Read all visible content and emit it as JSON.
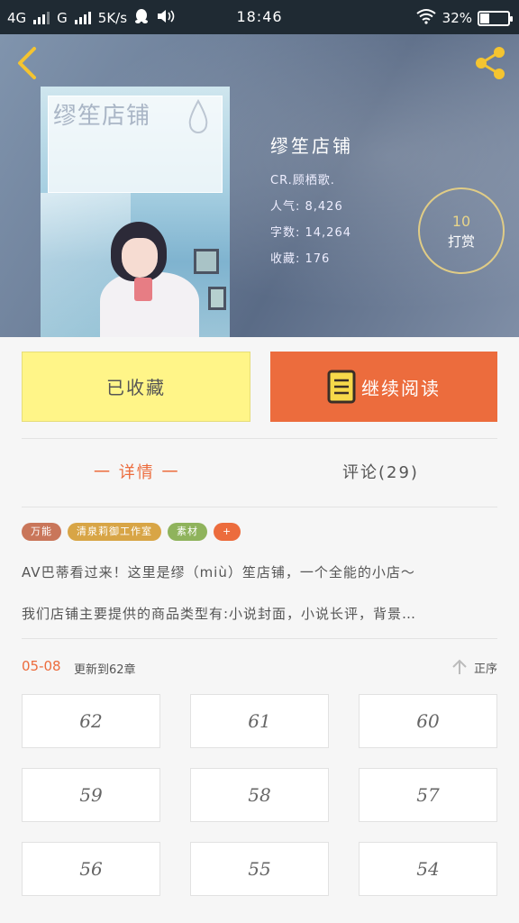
{
  "status_bar": {
    "network1": "4G",
    "network2": "G",
    "speed": "5K/s",
    "time": "18:46",
    "battery": "32%",
    "battery_level": 0.32,
    "icons": [
      "signal-icon",
      "qq-icon",
      "volume-icon",
      "wifi-icon",
      "battery-icon"
    ]
  },
  "header": {
    "back_icon": "chevron-left-icon",
    "share_icon": "share-icon"
  },
  "book": {
    "cover_title": "缪笙店铺",
    "title": "缪笙店铺",
    "author_line": "CR.顾栖歌.",
    "popularity_line": "人气: 8,426",
    "word_count_line": "字数: 14,264",
    "favorites_line": "收藏: 176"
  },
  "reward": {
    "count": "10",
    "label": "打赏"
  },
  "actions": {
    "collect_label": "已收藏",
    "read_label": "继续阅读",
    "read_icon": "book-icon"
  },
  "tabs": {
    "details": "一 详情 一",
    "comments": "评论(29)"
  },
  "tags": [
    {
      "label": "万能",
      "color": "#c9765a"
    },
    {
      "label": "清泉莉御工作室",
      "color": "#d8a546"
    },
    {
      "label": "素材",
      "color": "#8fb35c"
    },
    {
      "label": "+",
      "color": "#ec6c3d"
    }
  ],
  "description": {
    "line1": "AV巴蒂看过来！这里是缪（miù）笙店铺，一个全能的小店～",
    "line2": "我们店铺主要提供的商品类型有:小说封面，小说长评，背景…"
  },
  "update": {
    "date": "05-08",
    "text": "更新到62章",
    "sort_label": "正序",
    "sort_icon": "arrow-up-icon"
  },
  "chapters": [
    "62",
    "61",
    "60",
    "59",
    "58",
    "57",
    "56",
    "55",
    "54"
  ],
  "colors": {
    "accent": "#ec6c3d",
    "collect_bg": "#fff588",
    "reward_ring": "#e0cc86"
  }
}
